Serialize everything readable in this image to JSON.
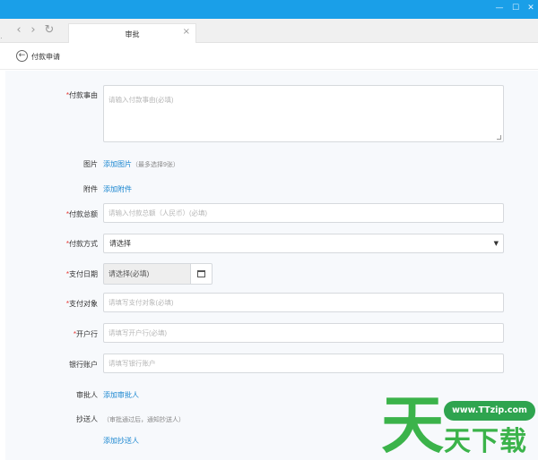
{
  "window": {
    "minimize": "—",
    "maximize": "☐",
    "close": "✕"
  },
  "browser": {
    "back": "‹",
    "forward": "›",
    "reload": "↻",
    "tab_title": "审批",
    "tab_close": "×",
    "left_mark": "·"
  },
  "header": {
    "back": "←",
    "title": "付款申请"
  },
  "form": {
    "reason": {
      "label": "付款事由",
      "required": "*",
      "placeholder": "请输入付款事由(必填)"
    },
    "images": {
      "label": "图片",
      "link": "添加图片",
      "hint": "（最多选择9张）"
    },
    "attachments": {
      "label": "附件",
      "link": "添加附件"
    },
    "amount": {
      "label": "付款总额",
      "required": "*",
      "placeholder": "请输入付款总额（人民币）(必填)"
    },
    "method": {
      "label": "付款方式",
      "required": "*",
      "value": "请选择",
      "caret": "▼"
    },
    "date": {
      "label": "支付日期",
      "required": "*",
      "value": "请选择(必填)"
    },
    "payee": {
      "label": "支付对象",
      "required": "*",
      "placeholder": "请填写支付对象(必填)"
    },
    "bank": {
      "label": "开户行",
      "required": "*",
      "placeholder": "请填写开户行(必填)"
    },
    "account": {
      "label": "银行账户",
      "placeholder": "请填写银行账户"
    },
    "approver": {
      "label": "审批人",
      "link": "添加审批人"
    },
    "cc": {
      "label": "抄送人",
      "hint": "（审批通过后，通知抄送人）",
      "link": "添加抄送人"
    }
  },
  "watermark": {
    "big": "天",
    "url": "www.TTzip.com",
    "small": "天下载"
  },
  "colors": {
    "titlebar": "#1a9fe8",
    "link": "#1a86d0",
    "required": "#e53935",
    "watermark": "#3bb34a"
  }
}
